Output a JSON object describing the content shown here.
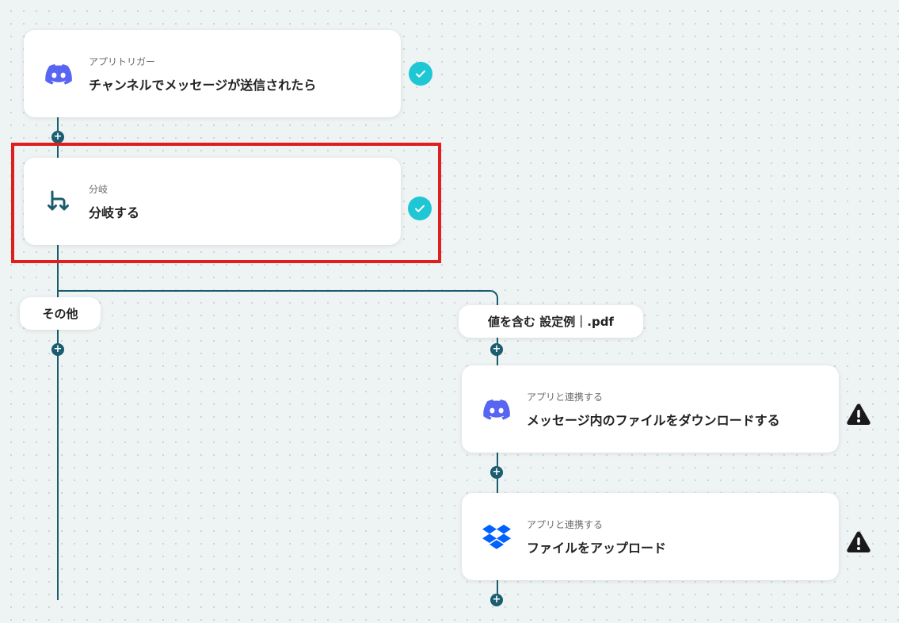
{
  "trigger_card": {
    "subtitle": "アプリトリガー",
    "title": "チャンネルでメッセージが送信されたら",
    "icon": "discord-icon",
    "status": "complete"
  },
  "branch_card": {
    "subtitle": "分岐",
    "title": "分岐する",
    "icon": "branch-icon",
    "status": "complete"
  },
  "branches": {
    "other": {
      "label": "その他"
    },
    "condition": {
      "label": "値を含む 設定例｜.pdf"
    }
  },
  "download_card": {
    "subtitle": "アプリと連携する",
    "title": "メッセージ内のファイルをダウンロードする",
    "icon": "discord-icon",
    "status": "warning"
  },
  "upload_card": {
    "subtitle": "アプリと連携する",
    "title": "ファイルをアップロード",
    "icon": "dropbox-icon",
    "status": "warning"
  },
  "colors": {
    "line": "#1b5c6e",
    "check": "#1fc6d4",
    "highlight": "#e01e1e",
    "discord": "#5865f2",
    "dropbox": "#0061fe"
  }
}
